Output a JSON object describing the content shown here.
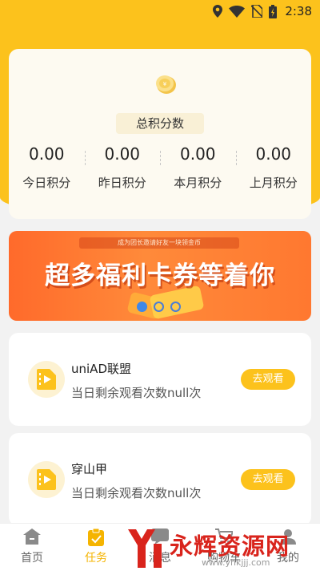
{
  "status_bar": {
    "time": "2:38"
  },
  "points": {
    "total_label": "总积分数",
    "stats": [
      {
        "value": "0.00",
        "label": "今日积分"
      },
      {
        "value": "0.00",
        "label": "昨日积分"
      },
      {
        "value": "0.00",
        "label": "本月积分"
      },
      {
        "value": "0.00",
        "label": "上月积分"
      }
    ]
  },
  "banner": {
    "ribbon": "成为团长邀请好友一块领金币",
    "headline": "超多福利卡券等着你",
    "active_slide": 1,
    "slide_count": 3
  },
  "tasks": [
    {
      "title": "uniAD联盟",
      "desc": "当日剩余观看次数null次",
      "button": "去观看"
    },
    {
      "title": "穿山甲",
      "desc": "当日剩余观看次数null次",
      "button": "去观看"
    }
  ],
  "nav": {
    "items": [
      {
        "label": "首页"
      },
      {
        "label": "任务"
      },
      {
        "label": "消息"
      },
      {
        "label": "购物车"
      },
      {
        "label": "我的"
      }
    ],
    "active": "任务"
  },
  "watermark": {
    "text": "永辉资源网",
    "url": "www.yhkjjj.com"
  },
  "colors": {
    "accent": "#fcc21c",
    "banner": "#ff6a2b",
    "active_nav": "#f5b400"
  }
}
